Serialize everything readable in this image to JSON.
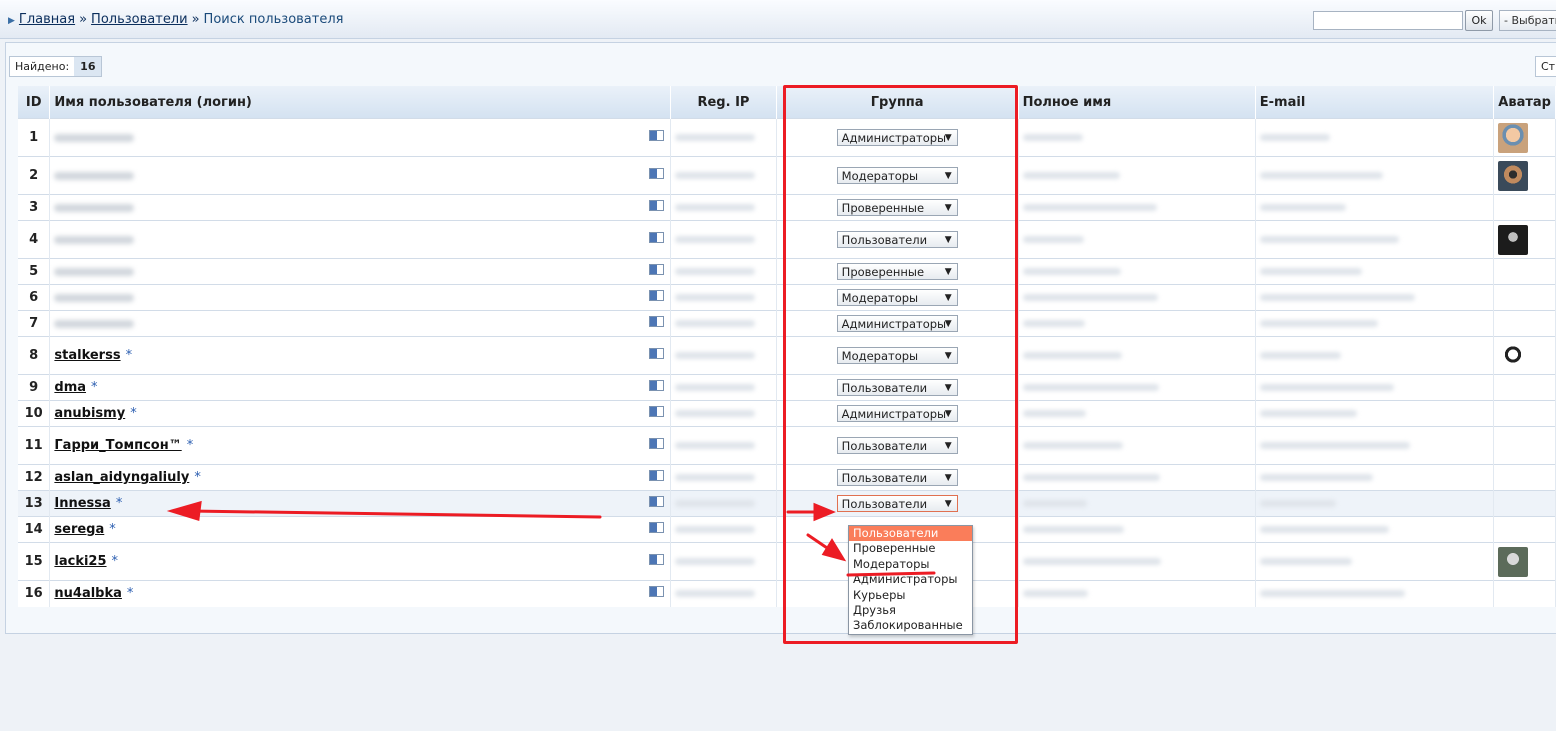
{
  "breadcrumb": {
    "home": "Главная",
    "users": "Пользователи",
    "current": "Поиск пользователя",
    "sep": "»"
  },
  "toolbar": {
    "search_value": "",
    "ok_label": "Ok",
    "select_label": "- Выбрать -"
  },
  "found": {
    "label": "Найдено:",
    "count": "16"
  },
  "pages_label": "Стр",
  "columns": {
    "id": "ID",
    "login": "Имя пользователя (логин)",
    "ip": "Reg. IP",
    "group": "Группа",
    "fullname": "Полное имя",
    "email": "E-mail",
    "avatar": "Аватар"
  },
  "rows": [
    {
      "id": "1",
      "login": "",
      "star": "",
      "group": "Администраторы",
      "avatar": "cartoon"
    },
    {
      "id": "2",
      "login": "",
      "star": "",
      "group": "Модераторы",
      "avatar": "sunglasses"
    },
    {
      "id": "3",
      "login": "",
      "star": "",
      "group": "Проверенные",
      "avatar": ""
    },
    {
      "id": "4",
      "login": "",
      "star": "",
      "group": "Пользователи",
      "avatar": "dark"
    },
    {
      "id": "5",
      "login": "",
      "star": "",
      "group": "Проверенные",
      "avatar": ""
    },
    {
      "id": "6",
      "login": "",
      "star": "",
      "group": "Модераторы",
      "avatar": ""
    },
    {
      "id": "7",
      "login": "",
      "star": "",
      "group": "Администраторы",
      "avatar": ""
    },
    {
      "id": "8",
      "login": "stalkerss",
      "star": "*",
      "group": "Модераторы",
      "avatar": "skull"
    },
    {
      "id": "9",
      "login": "dma",
      "star": "*",
      "group": "Пользователи",
      "avatar": ""
    },
    {
      "id": "10",
      "login": "anubismy",
      "star": "*",
      "group": "Администраторы",
      "avatar": ""
    },
    {
      "id": "11",
      "login": "Гарри_Томпсон™",
      "star": "*",
      "group": "Пользователи",
      "avatar": ""
    },
    {
      "id": "12",
      "login": "aslan_aidyngaliuly",
      "star": "*",
      "group": "Пользователи",
      "avatar": ""
    },
    {
      "id": "13",
      "login": "Innessa",
      "star": "*",
      "group": "Пользователи",
      "avatar": ""
    },
    {
      "id": "14",
      "login": "serega",
      "star": "*",
      "group": "",
      "avatar": ""
    },
    {
      "id": "15",
      "login": "lacki25",
      "star": "*",
      "group": "",
      "avatar": "portrait"
    },
    {
      "id": "16",
      "login": "nu4albka",
      "star": "*",
      "group": "",
      "avatar": ""
    }
  ],
  "group_dropdown": {
    "selected": "Пользователи",
    "options": [
      "Пользователи",
      "Проверенные",
      "Модераторы",
      "Администраторы",
      "Курьеры",
      "Друзья",
      "Заблокированные"
    ]
  },
  "colors": {
    "annotation": "#ec1c24",
    "dropdown_highlight": "#fa7d5a"
  }
}
